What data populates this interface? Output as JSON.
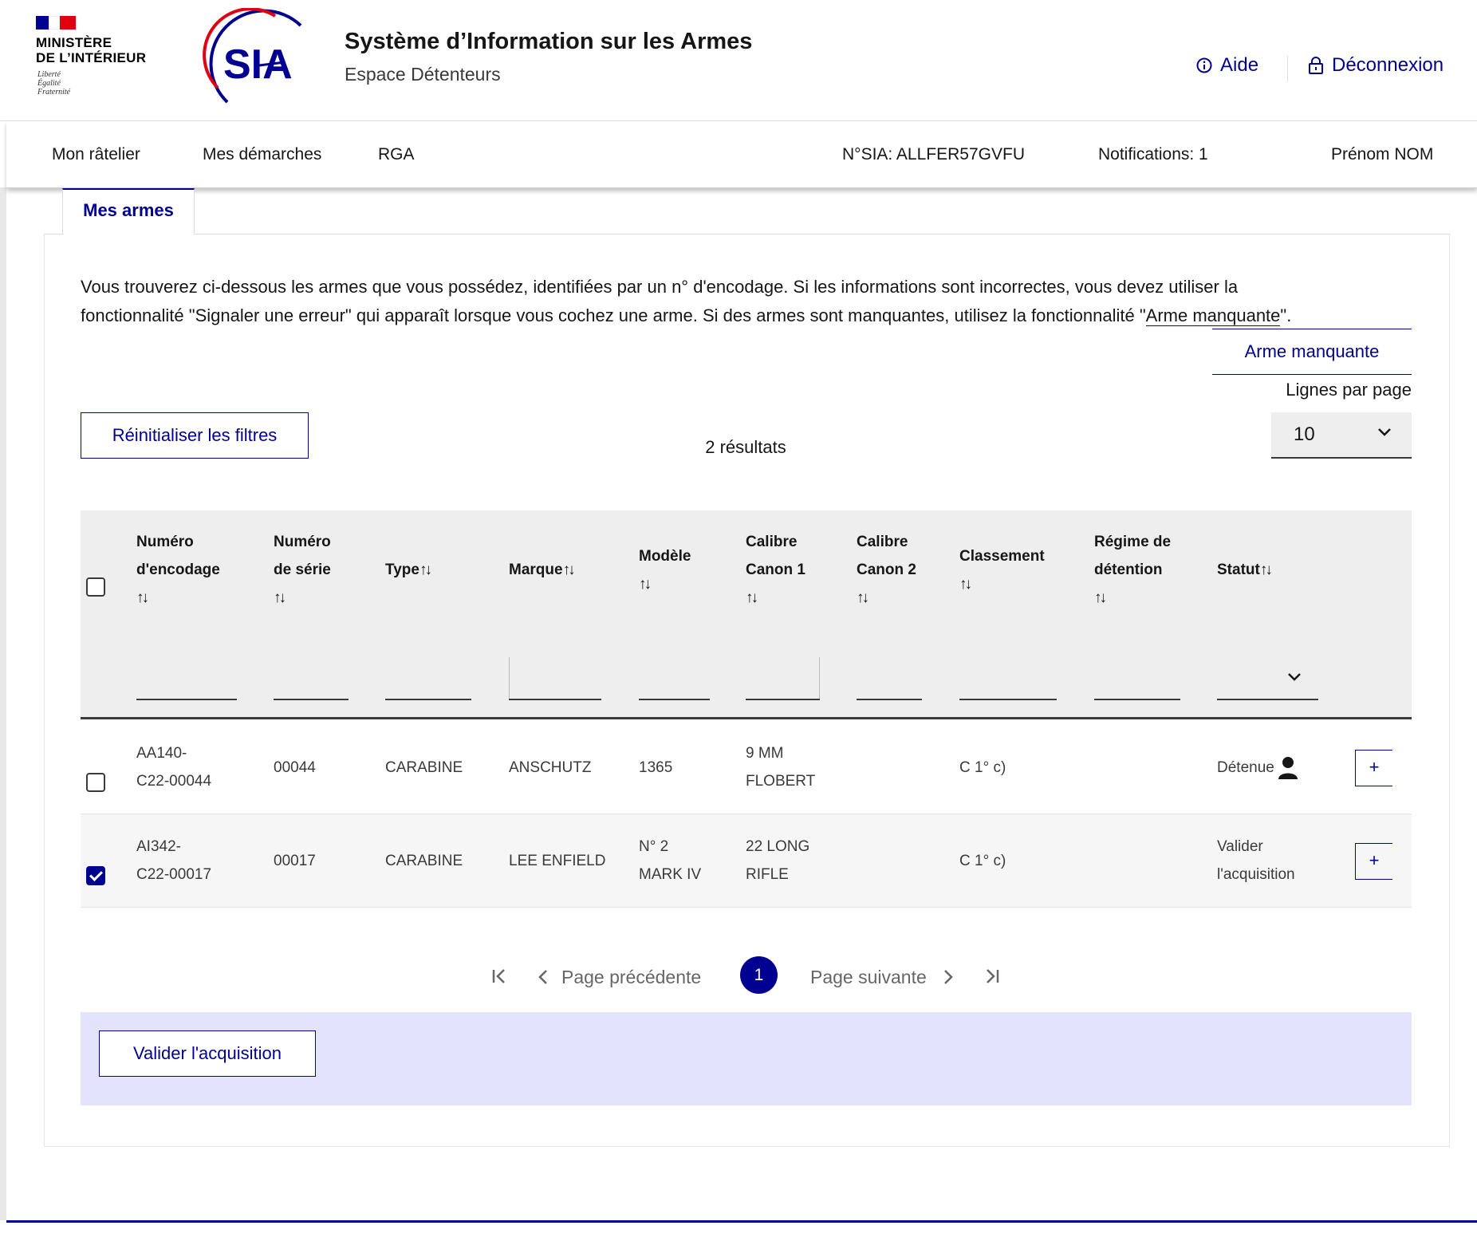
{
  "header": {
    "ministry_line1": "MINISTÈRE",
    "ministry_line2": "DE L’INTÉRIEUR",
    "devise_1": "Liberté",
    "devise_2": "Égalité",
    "devise_3": "Fraternité",
    "logo_text": "SIA",
    "title": "Système d’Information sur les Armes",
    "subtitle": "Espace Détenteurs",
    "help_label": "Aide",
    "logout_label": "Déconnexion"
  },
  "nav": {
    "items": [
      "Mon râtelier",
      "Mes démarches",
      "RGA"
    ],
    "sia_number": "N°SIA: ALLFER57GVFU",
    "notifications": "Notifications: 1",
    "user_name": "Prénom NOM"
  },
  "tab": {
    "label": "Mes armes"
  },
  "intro": {
    "line1": "Vous trouverez ci-dessous les armes que vous possédez, identifiées par un n° d'encodage. Si les informations sont incorrectes, vous devez utiliser la",
    "line2_before": "fonctionnalité \"Signaler une erreur\" qui apparaît lorsque vous cochez une arme. Si des armes sont manquantes, utilisez la fonctionnalité \"",
    "line2_link": "Arme manquante",
    "line2_after": "\"."
  },
  "controls": {
    "missing_button": "Arme manquante",
    "lines_per_page_label": "Lignes par page",
    "lines_per_page_value": "10",
    "reset_button": "Réinitialiser les filtres",
    "results_count": "2 résultats"
  },
  "table": {
    "headers": {
      "encodage_1": "Numéro",
      "encodage_2": "d'encodage",
      "serie_1": "Numéro",
      "serie_2": "de série",
      "type": "Type",
      "marque": "Marque",
      "modele": "Modèle",
      "calibre1_1": "Calibre",
      "calibre1_2": "Canon 1",
      "calibre2_1": "Calibre",
      "calibre2_2": "Canon 2",
      "classement": "Classement",
      "regime_1": "Régime de",
      "regime_2": "détention",
      "statut": "Statut"
    },
    "sort_glyph": "↑↓",
    "rows": [
      {
        "encodage_1": "AA140-",
        "encodage_2": "C22-00044",
        "serie": "00044",
        "type": "CARABINE",
        "marque": "ANSCHUTZ",
        "modele_1": "1365",
        "modele_2": "",
        "calibre1_1": "9 MM",
        "calibre1_2": "FLOBERT",
        "classement": "C 1° c)",
        "statut_1": "Détenue",
        "statut_2": "",
        "checked": false
      },
      {
        "encodage_1": "AI342-",
        "encodage_2": "C22-00017",
        "serie": "00017",
        "type": "CARABINE",
        "marque": "LEE ENFIELD",
        "modele_1": "N° 2",
        "modele_2": "MARK IV",
        "calibre1_1": "22 LONG",
        "calibre1_2": "RIFLE",
        "classement": "C 1° c)",
        "statut_1": "Valider",
        "statut_2": "l'acquisition",
        "checked": true
      }
    ],
    "plus_label": "+"
  },
  "pagination": {
    "previous": "Page précédente",
    "current": "1",
    "next": "Page suivante"
  },
  "actions": {
    "validate_button": "Valider l'acquisition"
  },
  "colors": {
    "primary": "#000091",
    "action_bar": "#e3e3fd",
    "header_bg": "#eeeeee",
    "red": "#e1000f"
  }
}
